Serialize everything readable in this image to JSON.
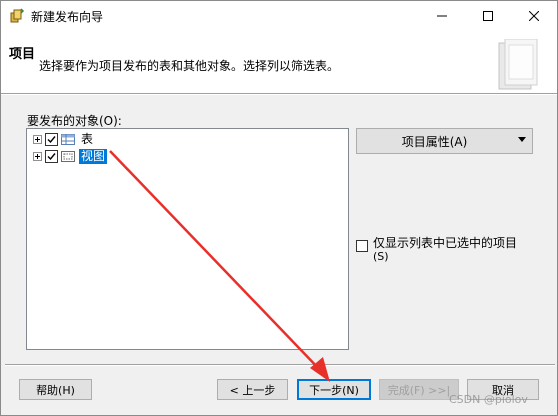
{
  "window": {
    "title": "新建发布向导",
    "controls": {
      "minimize": "minimize-icon",
      "maximize": "maximize-icon",
      "close": "close-icon"
    }
  },
  "header": {
    "title": "项目",
    "description": "选择要作为项目发布的表和其他对象。选择列以筛选表。"
  },
  "tree": {
    "label": "要发布的对象(O):",
    "items": [
      {
        "label": "表",
        "checked": true,
        "selected": false,
        "icon": "table-icon"
      },
      {
        "label": "视图",
        "checked": true,
        "selected": true,
        "icon": "view-icon"
      }
    ]
  },
  "properties": {
    "label": "项目属性(A)"
  },
  "filter": {
    "label": "仅显示列表中已选中的项目",
    "accesskey": "(S)",
    "checked": false
  },
  "buttons": {
    "help": "帮助(H)",
    "back": "< 上一步",
    "next": "下一步(N)",
    "finish": "完成(F) >>|",
    "cancel": "取消"
  },
  "watermark": "CSDN @piolov",
  "annotation": {
    "color": "#e8302a"
  },
  "colors": {
    "selection": "#0078d7",
    "window_bg": "#f0f0f0",
    "arrow": "#e8302a"
  }
}
